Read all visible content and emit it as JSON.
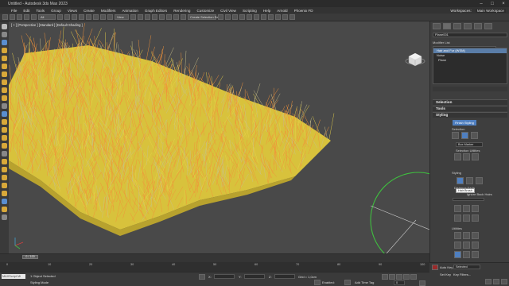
{
  "app": {
    "title": "Untitled - Autodesk 3ds Max 2023"
  },
  "menu": [
    "File",
    "Edit",
    "Tools",
    "Group",
    "Views",
    "Create",
    "Modifiers",
    "Animation",
    "Graph Editors",
    "Rendering",
    "Customize",
    "Civil View",
    "Scripting",
    "Help",
    "Arnold",
    "Phoenix FD"
  ],
  "workspaces": {
    "label": "Workspaces:",
    "value": "Main Workspace"
  },
  "toolbar": {
    "filter": "All",
    "view": "View",
    "create_selection_set": "Create Selection Se"
  },
  "viewport": {
    "label": "[ + ] [Perspective ] [Standard ] [Default Shading ]"
  },
  "command_panel": {
    "object_name": "Plane001",
    "modifier_list_label": "Modifier List",
    "stack": [
      {
        "label": "Hair and Fur (WSM)",
        "selected": true
      },
      {
        "label": "Noise",
        "selected": false
      },
      {
        "label": "Plane",
        "selected": false
      }
    ],
    "rollouts": {
      "selection": "Selection",
      "tools": "Tools",
      "styling": "Styling"
    },
    "styling": {
      "finish_button": "Finish Styling",
      "selection_label": "Selection",
      "box_marker": "Box Marker",
      "selection_utilities": "Selection Utilities",
      "styling_label": "Styling",
      "distance_fade": "Distance Fade",
      "ignore_back_hairs": "Ignore Back Hairs",
      "tooltip": "Hair Brush",
      "utilities_label": "Utilities"
    }
  },
  "timeline": {
    "frame_display": "0 / 100",
    "ticks": [
      "0",
      "10",
      "20",
      "30",
      "40",
      "50",
      "60",
      "70",
      "80",
      "90",
      "100"
    ]
  },
  "status": {
    "maxscript_placeholder": "MAXScript Mi",
    "selection": "1 Object Selected",
    "prompt": "Styling Mode",
    "x_label": "X:",
    "y_label": "Y:",
    "z_label": "Z:",
    "grid": "Grid = 1,0cm",
    "enabled_label": "Enabled:",
    "add_time_tag": "Add Time Tag",
    "auto_key": "Auto Key",
    "selected_dropdown": "Selected",
    "set_key": "Set Key",
    "key_filters": "Key Filters...",
    "frame_field": "0"
  },
  "colors": {
    "hair_orange": "#f2923a",
    "hair_yellow": "#e8d24a",
    "accent_blue": "#4f7fc0",
    "gizmo_green": "#3fbf3f"
  }
}
